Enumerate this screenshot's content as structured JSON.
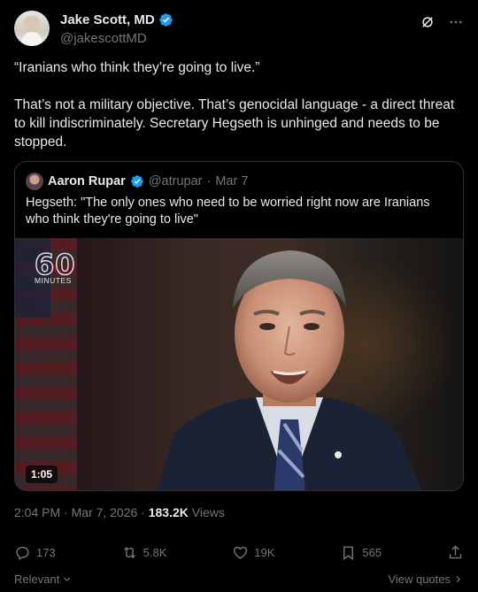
{
  "author": {
    "display_name": "Jake Scott, MD",
    "handle": "@jakescottMD"
  },
  "icons": {
    "verified": "verified-badge-icon",
    "grok": "grok-icon",
    "more": "more-icon",
    "reply": "reply-icon",
    "repost": "repost-icon",
    "like": "heart-icon",
    "bookmark": "bookmark-icon",
    "share": "share-icon"
  },
  "colors": {
    "verified": "#1d9bf0",
    "muted": "#71767b",
    "text": "#e7e9ea",
    "border": "#2f3336"
  },
  "tweet": {
    "text": "“Iranians who think they’re going to live.”\n\nThat’s not a military objective. That’s genocidal language - a direct threat to kill indiscriminately. Secretary Hegseth is unhinged and needs to be stopped."
  },
  "quote": {
    "display_name": "Aaron Rupar",
    "handle": "@atrupar",
    "separator": "·",
    "date": "Mar 7",
    "text": "Hegseth: \"The only ones who need to be worried right now are Iranians who think they're going to live\"",
    "video": {
      "logo_number": "60",
      "logo_text": "MINUTES",
      "duration": "1:05"
    }
  },
  "meta": {
    "time_date": "2:04 PM · Mar 7, 2026 · ",
    "views_count": "183.2K",
    "views_label": " Views"
  },
  "actions": {
    "replies": "173",
    "reposts": "5.8K",
    "likes": "19K",
    "bookmarks": "565"
  },
  "footer": {
    "relevant": "Relevant",
    "view_quotes": "View quotes"
  }
}
